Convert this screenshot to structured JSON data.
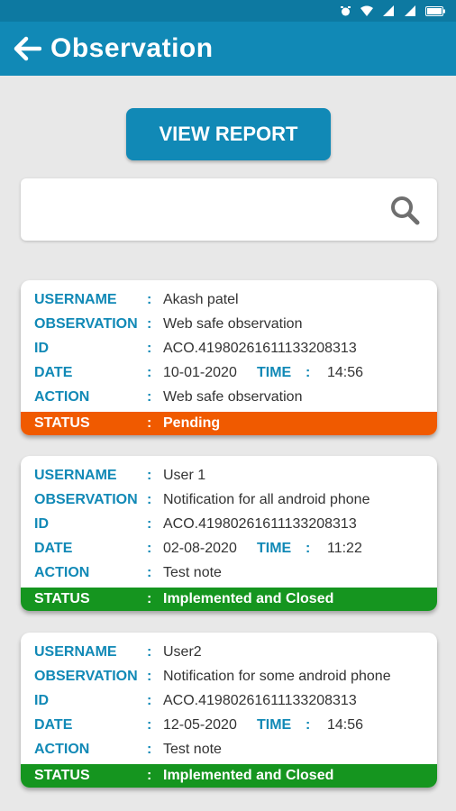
{
  "app_bar": {
    "title": "Observation"
  },
  "view_report_label": "VIEW REPORT",
  "search": {
    "placeholder": ""
  },
  "labels": {
    "username": "USERNAME",
    "observation": "OBSERVATION",
    "id": "ID",
    "date": "DATE",
    "time": "TIME",
    "action": "ACTION",
    "status": "STATUS",
    "colon": ":"
  },
  "status_colors": {
    "pending": "#f05a00",
    "closed": "#15951f"
  },
  "cards": [
    {
      "username": "Akash patel",
      "observation": "Web safe observation",
      "id": "ACO.41980261611133208313",
      "date": "10-01-2020",
      "time": "14:56",
      "action": "Web safe observation",
      "status": "Pending",
      "status_color": "#f05a00"
    },
    {
      "username": "User 1",
      "observation": "Notification for all android phone",
      "id": "ACO.41980261611133208313",
      "date": "02-08-2020",
      "time": "11:22",
      "action": "Test note",
      "status": "Implemented and Closed",
      "status_color": "#15951f"
    },
    {
      "username": "User2",
      "observation": "Notification for some android phone",
      "id": "ACO.41980261611133208313",
      "date": "12-05-2020",
      "time": "14:56",
      "action": "Test note",
      "status": "Implemented and Closed",
      "status_color": "#15951f"
    }
  ]
}
